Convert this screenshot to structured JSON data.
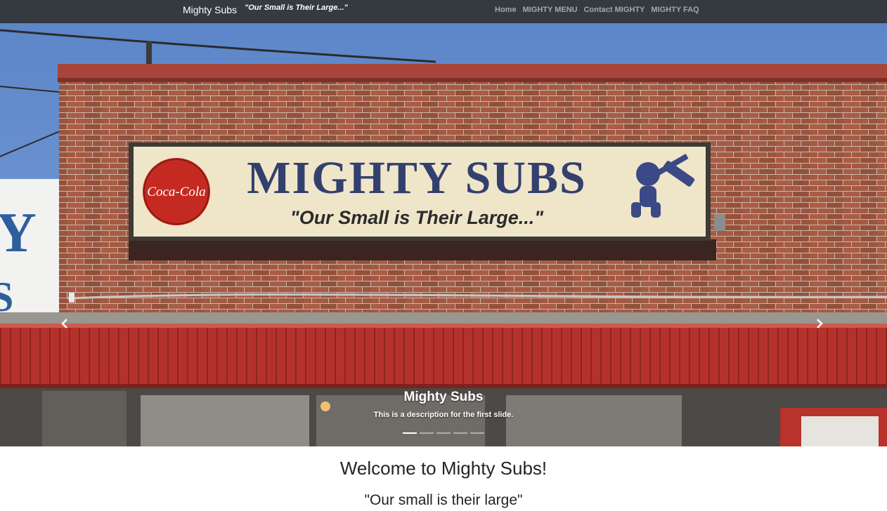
{
  "navbar": {
    "brand": "Mighty Subs",
    "tagline": "\"Our Small is Their Large...\"",
    "links": [
      {
        "label": "Home"
      },
      {
        "label": "MIGHTY MENU"
      },
      {
        "label": "Contact MIGHTY"
      },
      {
        "label": "MIGHTY FAQ"
      }
    ]
  },
  "carousel": {
    "image": {
      "sign_title": "MIGHTY SUBS",
      "sign_slogan": "\"Our Small is Their Large...\"",
      "sign_logo": "Coca-Cola"
    },
    "caption_title": "Mighty Subs",
    "caption_description": "This is a description for the first slide.",
    "slide_count": 5,
    "active_slide": 1,
    "prev_icon": "chevron-left-icon",
    "next_icon": "chevron-right-icon"
  },
  "main": {
    "welcome": "Welcome to Mighty Subs!",
    "motto": "\"Our small is their large\""
  },
  "colors": {
    "navbar_bg": "#343a40",
    "page_bg": "#ffffff",
    "text": "#212529"
  }
}
